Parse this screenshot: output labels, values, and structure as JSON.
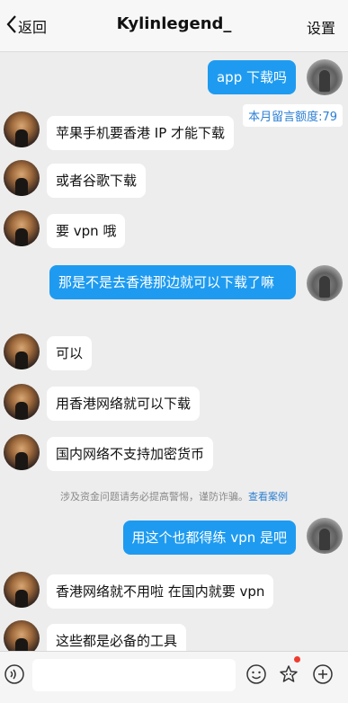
{
  "header": {
    "back_label": "返回",
    "title": "Kylinlegend_",
    "settings_label": "设置"
  },
  "quota_label": "本月留言额度:79",
  "messages": [
    {
      "side": "out",
      "text": "app 下载吗"
    },
    {
      "side": "in",
      "text": "苹果手机要香港 IP 才能下载"
    },
    {
      "side": "in",
      "text": "或者谷歌下载"
    },
    {
      "side": "in",
      "text": "要 vpn 哦"
    },
    {
      "side": "out",
      "text": "那是不是去香港那边就可以下载了嘛"
    },
    {
      "side": "in",
      "text": "可以"
    },
    {
      "side": "in",
      "text": "用香港网络就可以下载"
    },
    {
      "side": "in",
      "text": "国内网络不支持加密货币"
    },
    {
      "side": "out",
      "text": "用这个也都得练 vpn 是吧"
    },
    {
      "side": "in",
      "text": "香港网络就不用啦 在国内就要 vpn"
    },
    {
      "side": "in",
      "text": "这些都是必备的工具"
    }
  ],
  "notice": {
    "text": "涉及资金问题请务必提高警惕，谨防诈骗。",
    "link": "查看案例"
  },
  "composer": {
    "placeholder": ""
  },
  "icons": {
    "back": "chevron-left-icon",
    "voice": "voice-icon",
    "emoji": "emoji-icon",
    "star": "star-badge-icon",
    "plus": "plus-icon"
  },
  "colors": {
    "outgoing_bubble": "#1e9bf0",
    "incoming_bubble": "#ffffff",
    "background": "#ededed",
    "link": "#2f7fd1",
    "badge": "#f03b2f"
  }
}
